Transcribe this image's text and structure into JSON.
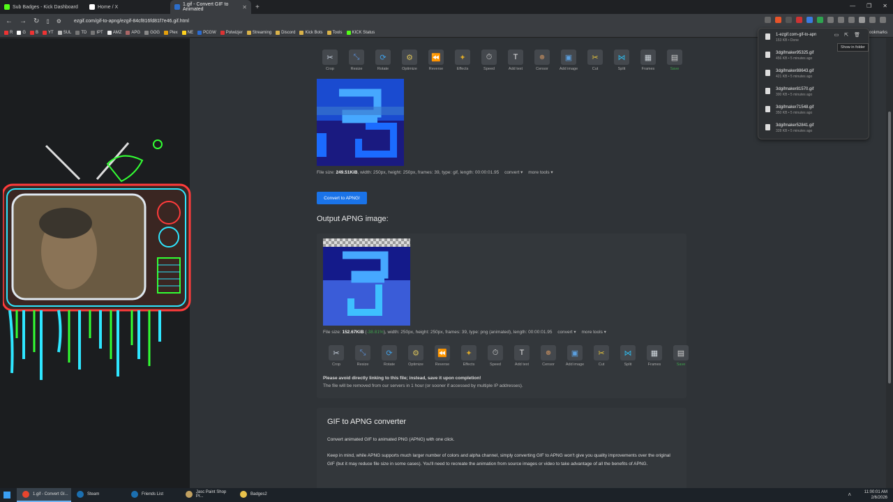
{
  "browser": {
    "tabs": [
      {
        "label": "Sub Badges - Kick Dashboard",
        "color": "#53fc18"
      },
      {
        "label": "Home / X",
        "color": "#ffffff"
      },
      {
        "label": "1.gif - Convert GIF to Animated",
        "color": "#2c6ecb",
        "active": true
      }
    ],
    "url": "ezgif.com/gif-to-apng/ezgif-84cf816fd81f7e46.gif.html",
    "bookmarks": [
      "R",
      "G",
      "B",
      "YT",
      "SUL",
      "TD",
      "IPT",
      "AMZ",
      "APG",
      "GOG",
      "Plex",
      "NE",
      "PCGW",
      "Polwizjer",
      "Streaming",
      "Discord",
      "Kick Bots",
      "Tools",
      "KICK Status"
    ],
    "bookmarks_right": "bookmarks"
  },
  "tools": [
    "Crop",
    "Resize",
    "Rotate",
    "Optimize",
    "Reverse",
    "Effects",
    "Speed",
    "Add text",
    "Censor",
    "Add image",
    "Cut",
    "Split",
    "Frames",
    "Save"
  ],
  "input_info": {
    "prefix": "File size: ",
    "size": "249.51KiB",
    "rest": ", width: 250px, height: 250px, frames: 39, type: gif, length: 00:00:01.95",
    "convert": "convert ▾",
    "more": "more tools ▾"
  },
  "convert_button": "Convert to APNG!",
  "output_heading": "Output APNG image:",
  "output_info": {
    "prefix": "File size: ",
    "size": "152.67KiB",
    "pct": "-38.81%",
    "rest": ", width: 250px, height: 250px, frames: 39, type: png (animated), length: 00:00:01.95",
    "convert": "convert ▾",
    "more": "more tools ▾"
  },
  "notice": "Please avoid directly linking to this file; instead, save it upon completion!",
  "notice2": "The file will be removed from our servers in 1 hour (or sooner if accessed by multiple IP addresses).",
  "converter": {
    "title": "GIF to APNG converter",
    "p1": "Convert animated GIF to animated PNG (APNG) with one click.",
    "p2": "Keep in mind, while APNG supports much larger number of colors and alpha channel, simply converting GIF to APNG won't give you quality improvements over the original GIF (but it may reduce file size in some cases). You'll need to recreate the animation from source images or video to take advantage of all the benefits of APNG."
  },
  "downloads": [
    {
      "name": "1-ezgif.com-gif-to-apn",
      "status": "153 KB • Done"
    },
    {
      "name": "3dgifmaker95325.gif",
      "status": "456 KB • 5 minutes ago"
    },
    {
      "name": "3dgifmaker88643.gif",
      "status": "421 KB • 5 minutes ago"
    },
    {
      "name": "3dgifmaker81570.gif",
      "status": "300 KB • 5 minutes ago"
    },
    {
      "name": "3dgifmaker71548.gif",
      "status": "350 KB • 5 minutes ago"
    },
    {
      "name": "3dgifmaker52841.gif",
      "status": "328 KB • 5 minutes ago"
    }
  ],
  "tooltip": "Show in folder",
  "taskbar": [
    {
      "label": "1.gif - Convert GI...",
      "color": "#e8452e",
      "active": true
    },
    {
      "label": "Steam",
      "color": "#1b6fb0"
    },
    {
      "label": "Friends List",
      "color": "#1b6fb0"
    },
    {
      "label": "Jasc Paint Shop Pr...",
      "color": "#c0a060"
    },
    {
      "label": "Badges2",
      "color": "#e8c14a"
    }
  ],
  "clock": {
    "time": "11:00:01 AM",
    "date": "2/6/2026"
  }
}
